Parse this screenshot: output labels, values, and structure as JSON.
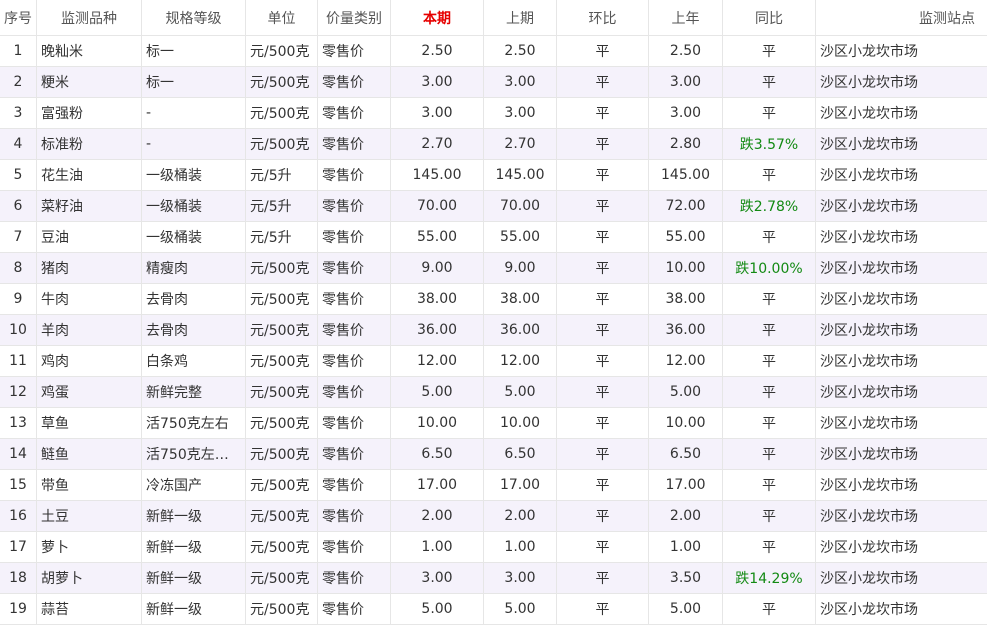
{
  "colors": {
    "current_header": "#e60000",
    "fall_text": "#138a13",
    "alt_row_bg": "#f5f2fb",
    "border": "#e6e6e6"
  },
  "table": {
    "headers": [
      "序号",
      "监测品种",
      "规格等级",
      "单位",
      "价量类别",
      "本期",
      "上期",
      "环比",
      "上年",
      "同比",
      "监测站点"
    ],
    "rows": [
      [
        "1",
        "晚籼米",
        "标一",
        "元/500克",
        "零售价",
        "2.50",
        "2.50",
        "平",
        "2.50",
        "平",
        "沙区小龙坎市场"
      ],
      [
        "2",
        "粳米",
        "标一",
        "元/500克",
        "零售价",
        "3.00",
        "3.00",
        "平",
        "3.00",
        "平",
        "沙区小龙坎市场"
      ],
      [
        "3",
        "富强粉",
        "-",
        "元/500克",
        "零售价",
        "3.00",
        "3.00",
        "平",
        "3.00",
        "平",
        "沙区小龙坎市场"
      ],
      [
        "4",
        "标准粉",
        "-",
        "元/500克",
        "零售价",
        "2.70",
        "2.70",
        "平",
        "2.80",
        "跌3.57%",
        "沙区小龙坎市场"
      ],
      [
        "5",
        "花生油",
        "一级桶装",
        "元/5升",
        "零售价",
        "145.00",
        "145.00",
        "平",
        "145.00",
        "平",
        "沙区小龙坎市场"
      ],
      [
        "6",
        "菜籽油",
        "一级桶装",
        "元/5升",
        "零售价",
        "70.00",
        "70.00",
        "平",
        "72.00",
        "跌2.78%",
        "沙区小龙坎市场"
      ],
      [
        "7",
        "豆油",
        "一级桶装",
        "元/5升",
        "零售价",
        "55.00",
        "55.00",
        "平",
        "55.00",
        "平",
        "沙区小龙坎市场"
      ],
      [
        "8",
        "猪肉",
        "精瘦肉",
        "元/500克",
        "零售价",
        "9.00",
        "9.00",
        "平",
        "10.00",
        "跌10.00%",
        "沙区小龙坎市场"
      ],
      [
        "9",
        "牛肉",
        "去骨肉",
        "元/500克",
        "零售价",
        "38.00",
        "38.00",
        "平",
        "38.00",
        "平",
        "沙区小龙坎市场"
      ],
      [
        "10",
        "羊肉",
        "去骨肉",
        "元/500克",
        "零售价",
        "36.00",
        "36.00",
        "平",
        "36.00",
        "平",
        "沙区小龙坎市场"
      ],
      [
        "11",
        "鸡肉",
        "白条鸡",
        "元/500克",
        "零售价",
        "12.00",
        "12.00",
        "平",
        "12.00",
        "平",
        "沙区小龙坎市场"
      ],
      [
        "12",
        "鸡蛋",
        "新鲜完整",
        "元/500克",
        "零售价",
        "5.00",
        "5.00",
        "平",
        "5.00",
        "平",
        "沙区小龙坎市场"
      ],
      [
        "13",
        "草鱼",
        "活750克左右",
        "元/500克",
        "零售价",
        "10.00",
        "10.00",
        "平",
        "10.00",
        "平",
        "沙区小龙坎市场"
      ],
      [
        "14",
        "鲢鱼",
        "活750克左右…",
        "元/500克",
        "零售价",
        "6.50",
        "6.50",
        "平",
        "6.50",
        "平",
        "沙区小龙坎市场"
      ],
      [
        "15",
        "带鱼",
        "冷冻国产",
        "元/500克",
        "零售价",
        "17.00",
        "17.00",
        "平",
        "17.00",
        "平",
        "沙区小龙坎市场"
      ],
      [
        "16",
        "土豆",
        "新鲜一级",
        "元/500克",
        "零售价",
        "2.00",
        "2.00",
        "平",
        "2.00",
        "平",
        "沙区小龙坎市场"
      ],
      [
        "17",
        "萝卜",
        "新鲜一级",
        "元/500克",
        "零售价",
        "1.00",
        "1.00",
        "平",
        "1.00",
        "平",
        "沙区小龙坎市场"
      ],
      [
        "18",
        "胡萝卜",
        "新鲜一级",
        "元/500克",
        "零售价",
        "3.00",
        "3.00",
        "平",
        "3.50",
        "跌14.29%",
        "沙区小龙坎市场"
      ],
      [
        "19",
        "蒜苔",
        "新鲜一级",
        "元/500克",
        "零售价",
        "5.00",
        "5.00",
        "平",
        "5.00",
        "平",
        "沙区小龙坎市场"
      ]
    ]
  }
}
